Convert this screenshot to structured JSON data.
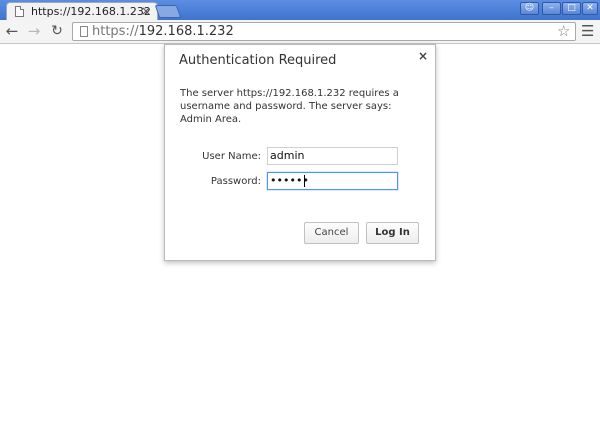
{
  "browser": {
    "tab_title": "https://192.168.1.232",
    "tab_close": "×",
    "url_scheme": "https://",
    "url_host": "192.168.1.232",
    "icons": {
      "back": "back-arrow-icon",
      "forward": "forward-arrow-icon",
      "reload": "reload-icon",
      "star": "bookmark-star-icon",
      "menu": "hamburger-menu-icon"
    }
  },
  "dialog": {
    "title": "Authentication Required",
    "close": "×",
    "message": "The server https://192.168.1.232 requires a username and password. The server says: Admin Area.",
    "username_label": "User Name:",
    "username_value": "admin",
    "password_label": "Password:",
    "password_value": "••••••",
    "cancel_label": "Cancel",
    "login_label": "Log In"
  }
}
